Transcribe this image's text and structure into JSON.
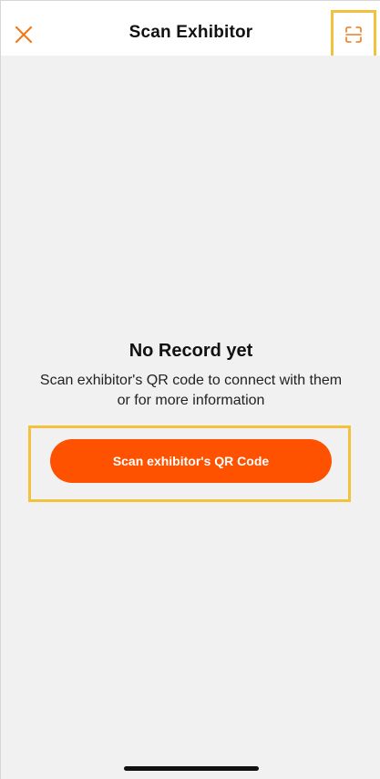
{
  "header": {
    "title": "Scan Exhibitor",
    "close_icon": "close-icon",
    "scan_icon": "qr-scan-icon"
  },
  "empty_state": {
    "title": "No Record yet",
    "description": "Scan exhibitor's QR code to connect with them or for more information",
    "button_label": "Scan exhibitor's QR Code"
  },
  "colors": {
    "accent": "#ff5200",
    "icon_orange": "#f07a1a",
    "highlight": "#f3c23c",
    "background": "#f1f1f1"
  }
}
